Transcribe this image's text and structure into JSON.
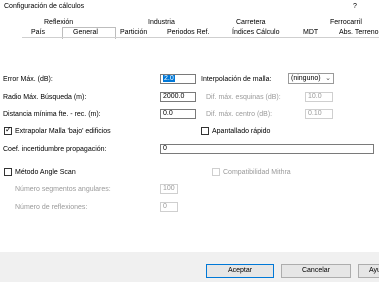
{
  "window": {
    "title": "Configuración de cálculos",
    "help": "?"
  },
  "tabs_row1": [
    "Reflexión",
    "Industria",
    "Carretera",
    "Ferrocarril"
  ],
  "tabs_row2": [
    "País",
    "General",
    "Partición",
    "Periodos Ref.",
    "Índices Cálculo",
    "MDT",
    "Abs. Terreno"
  ],
  "active_tab": "General",
  "form": {
    "error_label": "Error Máx. (dB):",
    "error_value": "2.0",
    "interp_label": "Interpolación de malla:",
    "interp_value": "(ninguno)",
    "radio_label": "Radio Máx. Búsqueda (m):",
    "radio_value": "2000.0",
    "dif_esquinas_label": "Dif. máx. esquinas (dB):",
    "dif_esquinas_value": "10.0",
    "dist_label": "Distancia mínima fte. - rec. (m):",
    "dist_value": "0.0",
    "dif_centro_label": "Dif. máx. centro (dB):",
    "dif_centro_value": "0.10",
    "extrapolar_label": "Extrapolar Malla 'bajo' edificios",
    "extrapolar_checked": true,
    "apantallado_label": "Apantallado rápido",
    "apantallado_checked": false,
    "coef_label": "Coef. incertidumbre propagación:",
    "coef_value": "0",
    "angle_label": "Método Angle Scan",
    "angle_checked": false,
    "mithra_label": "Compatibilidad Mithra",
    "mithra_checked": false,
    "segmentos_label": "Número segmentos angulares:",
    "segmentos_value": "100",
    "reflexiones_label": "Número de reflexiones:",
    "reflexiones_value": "0"
  },
  "buttons": {
    "accept": "Aceptar",
    "cancel": "Cancelar",
    "help": "Ayuda"
  }
}
